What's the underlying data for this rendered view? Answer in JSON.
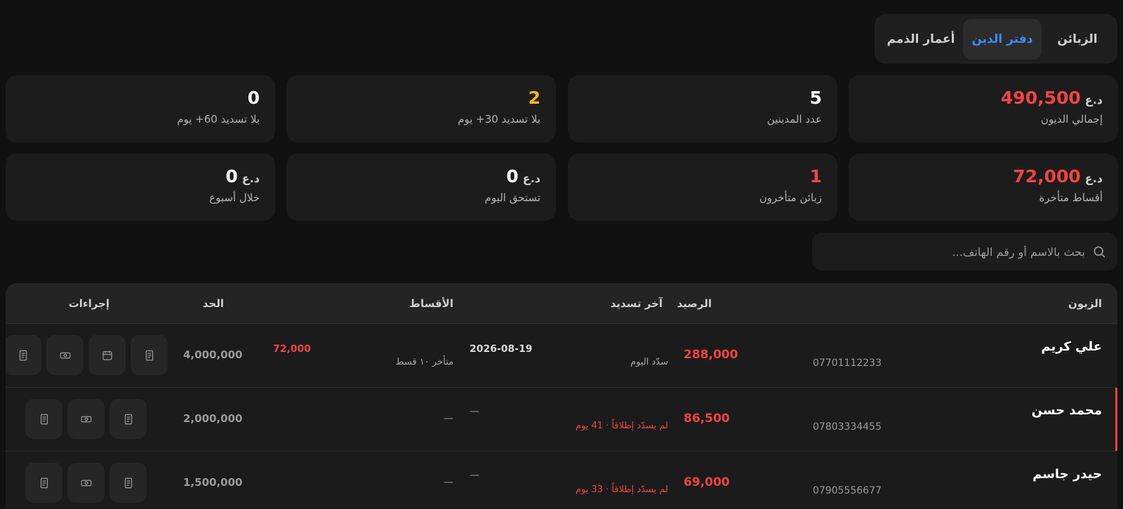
{
  "tabs": [
    {
      "label": "الزبائن",
      "active": false
    },
    {
      "label": "دفتر الدين",
      "active": true
    },
    {
      "label": "أعمار الذمم",
      "active": false
    }
  ],
  "stats": {
    "total_debts": {
      "value": "490,500",
      "currency": "د.ع",
      "label": "إجمالي الديون"
    },
    "debtor_count": {
      "value": "5",
      "label": "عدد المدينين"
    },
    "no_payment_30": {
      "value": "2",
      "label": "بلا تسديد 30+ يوم"
    },
    "no_payment_60": {
      "value": "0",
      "label": "بلا تسديد 60+ يوم"
    },
    "overdue_installments": {
      "value": "72,000",
      "currency": "د.ع",
      "label": "أقساط متأخرة"
    },
    "late_customers": {
      "value": "1",
      "label": "زبائن متأخرون"
    },
    "due_today": {
      "value": "0",
      "currency": "د.ع",
      "label": "تستحق اليوم"
    },
    "within_week": {
      "value": "0",
      "currency": "د.ع",
      "label": "خلال أسبوع"
    }
  },
  "search": {
    "placeholder": "بحث بالاسم أو رقم الهاتف..."
  },
  "table": {
    "headers": {
      "customer": "الزبون",
      "balance": "الرصيد",
      "last_payment": "آخر تسديد",
      "installments": "الأقساط",
      "limit": "الحد",
      "actions": "إجراءات"
    },
    "rows": [
      {
        "name": "علي كريم",
        "phone": "07701112233",
        "balance": "288,000",
        "last_payment_date": "2026-08-19",
        "last_payment_note": "سدّد اليوم",
        "installments_amount": "72,000",
        "installments_note": "متأخر ١٠ قسط",
        "limit": "4,000,000"
      },
      {
        "name": "محمد حسن",
        "phone": "07803334455",
        "balance": "86,500",
        "last_payment_date": "—",
        "last_payment_note": "لم يسدّد إطلاقاً · 41 يوم",
        "installments_amount": "",
        "installments_note": "—",
        "limit": "2,000,000"
      },
      {
        "name": "حيدر جاسم",
        "phone": "07905556677",
        "balance": "69,000",
        "last_payment_date": "—",
        "last_payment_note": "لم يسدّد إطلاقاً · 33 يوم",
        "installments_amount": "",
        "installments_note": "—",
        "limit": "1,500,000"
      }
    ]
  },
  "icons": {
    "receipt": "receipt-icon",
    "cash": "cash-icon",
    "calendar": "calendar-icon",
    "search": "search-icon"
  },
  "colors": {
    "accent": "#3b8bff",
    "danger": "#ef4444",
    "warning": "#f5b51c"
  }
}
